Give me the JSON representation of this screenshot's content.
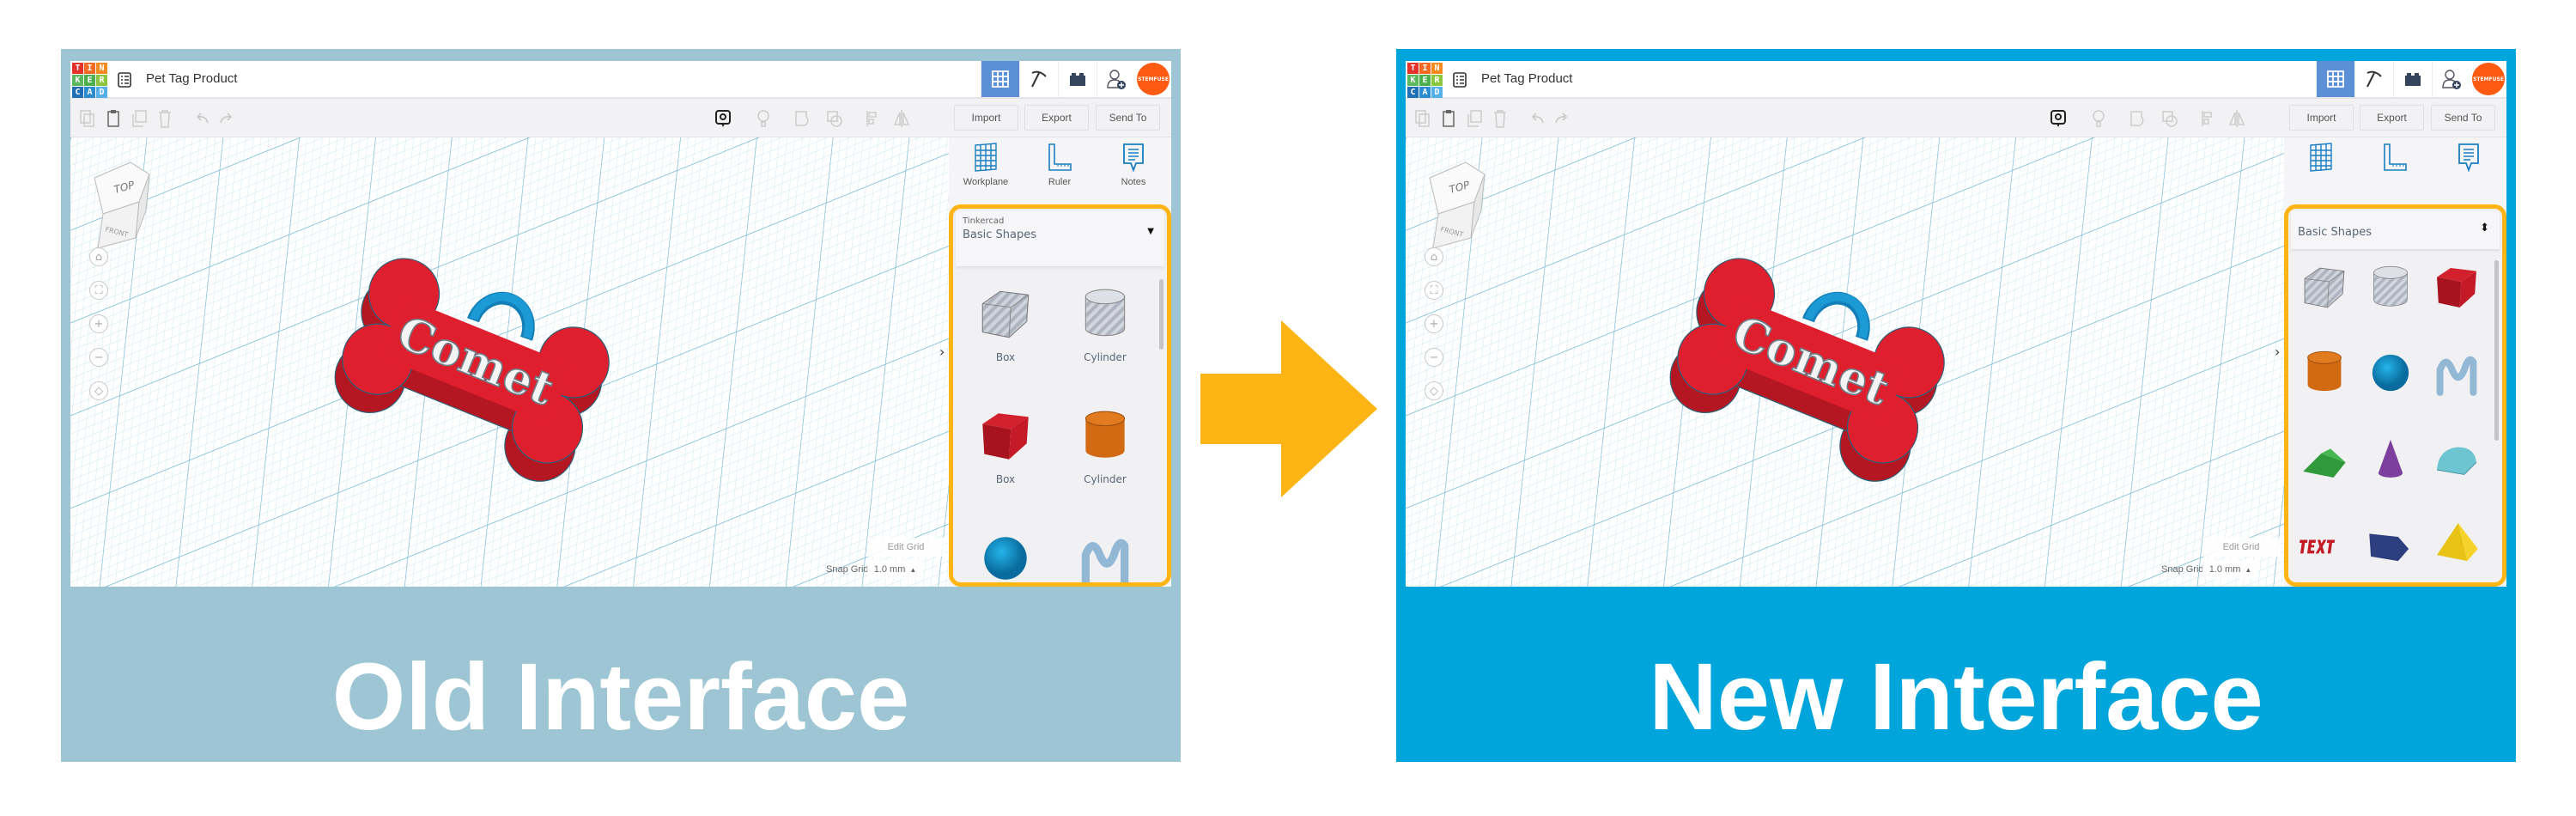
{
  "colors": {
    "arrow": "#fdb515",
    "highlight": "#fdb515",
    "old_bg": "#9dc5d3",
    "new_bg": "#00a5dc",
    "accent": "#5b8fd6",
    "avatar": "#ff5a12"
  },
  "arrow_icon": "right-arrow",
  "panels": {
    "old": {
      "caption": "Old Interface",
      "app": {
        "logo": [
          "T",
          "I",
          "N",
          "K",
          "E",
          "R",
          "C",
          "A",
          "D"
        ],
        "title": "Pet Tag Product",
        "avatar_logo": "STEMFUSE",
        "toolbar": {
          "import": "Import",
          "export": "Export",
          "send_to": "Send To"
        },
        "tools": [
          {
            "label": "Workplane"
          },
          {
            "label": "Ruler"
          },
          {
            "label": "Notes"
          }
        ],
        "view_cube": {
          "top": "TOP",
          "front": "FRONT"
        },
        "model_text": "Comet",
        "grid": {
          "edit": "Edit Grid",
          "snap_label": "Snap Grid",
          "snap_value": "1.0 mm"
        },
        "library": {
          "source": "Tinkercad",
          "category": "Basic Shapes",
          "shapes": [
            {
              "type": "box-hole",
              "label": "Box"
            },
            {
              "type": "cylinder-hole",
              "label": "Cylinder"
            },
            {
              "type": "box",
              "label": "Box"
            },
            {
              "type": "cylinder",
              "label": "Cylinder"
            },
            {
              "type": "sphere",
              "label": ""
            },
            {
              "type": "scribble",
              "label": ""
            }
          ]
        }
      }
    },
    "new": {
      "caption": "New Interface",
      "app": {
        "logo": [
          "T",
          "I",
          "N",
          "K",
          "E",
          "R",
          "C",
          "A",
          "D"
        ],
        "title": "Pet Tag Product",
        "avatar_logo": "STEMFUSE",
        "toolbar": {
          "import": "Import",
          "export": "Export",
          "send_to": "Send To"
        },
        "tools": [
          {
            "label": ""
          },
          {
            "label": ""
          },
          {
            "label": ""
          }
        ],
        "view_cube": {
          "top": "TOP",
          "front": "FRONT"
        },
        "model_text": "Comet",
        "grid": {
          "edit": "Edit Grid",
          "snap_label": "Snap Grid",
          "snap_value": "1.0 mm"
        },
        "library": {
          "category": "Basic Shapes",
          "shapes": [
            {
              "type": "box-hole"
            },
            {
              "type": "cylinder-hole"
            },
            {
              "type": "box"
            },
            {
              "type": "cylinder"
            },
            {
              "type": "sphere"
            },
            {
              "type": "scribble"
            },
            {
              "type": "roof"
            },
            {
              "type": "cone"
            },
            {
              "type": "round-roof"
            },
            {
              "type": "text"
            },
            {
              "type": "polygon"
            },
            {
              "type": "pyramid"
            },
            {
              "type": "polygon"
            }
          ]
        }
      }
    }
  }
}
